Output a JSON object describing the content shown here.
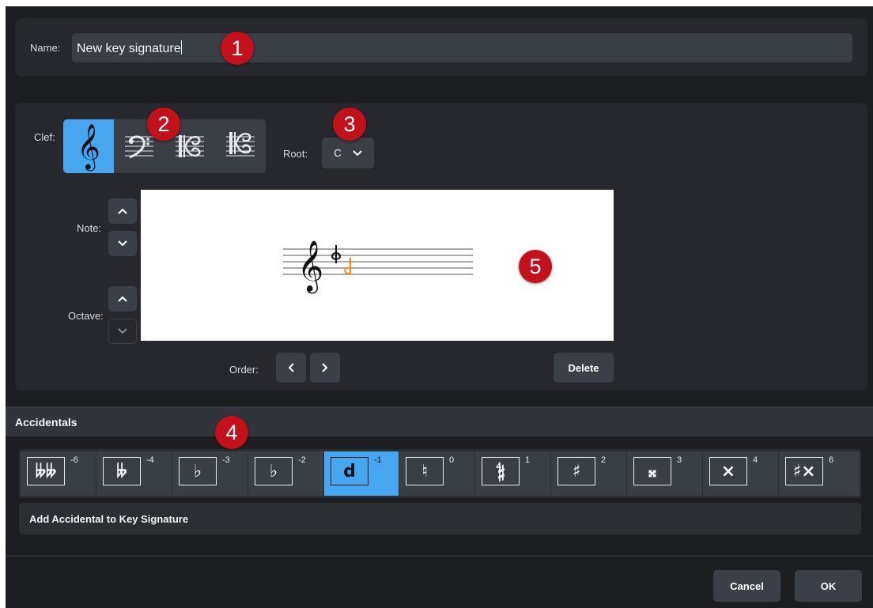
{
  "name_field": {
    "label": "Name:",
    "value": "New key signature"
  },
  "clef": {
    "label": "Clef:",
    "options": [
      {
        "name": "treble",
        "glyph": "𝄞",
        "selected": true
      },
      {
        "name": "bass",
        "glyph": "𝄢",
        "selected": false
      },
      {
        "name": "alto",
        "glyph": "𝄡",
        "selected": false
      },
      {
        "name": "tenor",
        "glyph": "𝄡",
        "selected": false
      }
    ]
  },
  "root": {
    "label": "Root:",
    "value": "C"
  },
  "note": {
    "label": "Note:"
  },
  "octave": {
    "label": "Octave:"
  },
  "order": {
    "label": "Order:"
  },
  "delete_label": "Delete",
  "accidentals": {
    "title": "Accidentals",
    "items": [
      {
        "glyph": "𝄫𝄫",
        "value": "-6",
        "selected": false
      },
      {
        "glyph": "𝄫",
        "value": "-4",
        "selected": false
      },
      {
        "glyph": "♭",
        "value": "-3",
        "selected": false
      },
      {
        "glyph": "♭",
        "value": "-2",
        "selected": false
      },
      {
        "glyph": "d",
        "value": "-1",
        "selected": true
      },
      {
        "glyph": "♮",
        "value": "0",
        "selected": false
      },
      {
        "glyph": "𝄲",
        "value": "1",
        "selected": false
      },
      {
        "glyph": "♯",
        "value": "2",
        "selected": false
      },
      {
        "glyph": "𝄪",
        "value": "3",
        "selected": false
      },
      {
        "glyph": "×",
        "value": "4",
        "selected": false
      },
      {
        "glyph": "♯×",
        "value": "6",
        "selected": false
      }
    ],
    "add_label": "Add Accidental to Key Signature"
  },
  "footer": {
    "cancel_label": "Cancel",
    "ok_label": "OK"
  },
  "callouts": [
    "1",
    "2",
    "3",
    "4",
    "5"
  ],
  "colors": {
    "accent": "#46a6f0",
    "callout": "#c2111b",
    "preview_accidental": "#f08c1e"
  }
}
